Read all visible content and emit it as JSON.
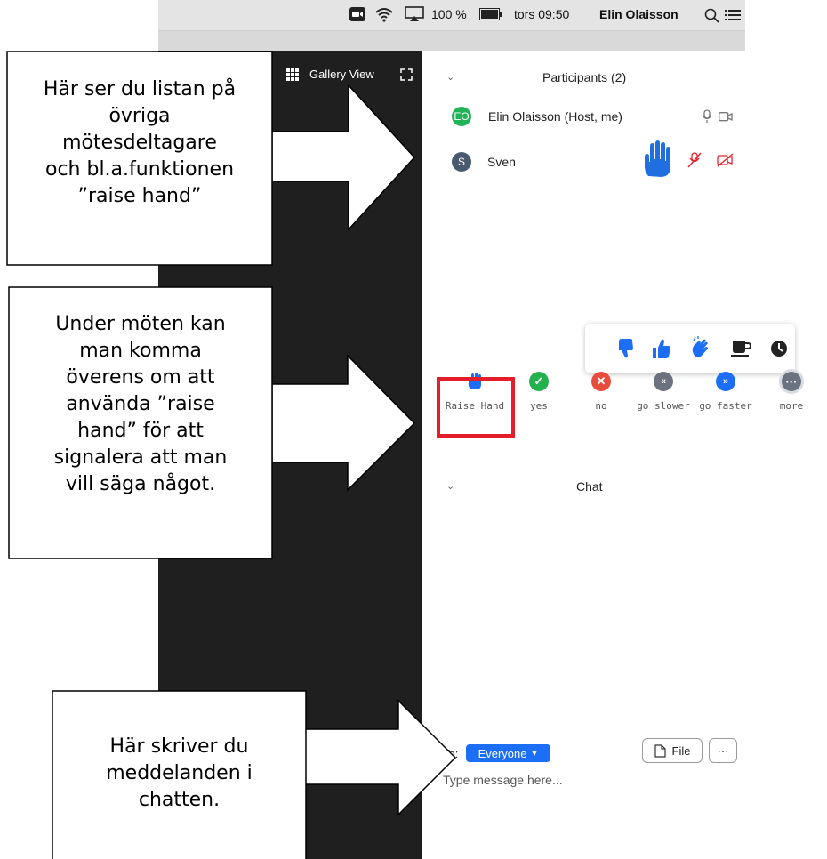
{
  "menubar": {
    "battery": "100 %",
    "datetime": "tors 09:50",
    "user": "Elin Olaisson"
  },
  "video": {
    "gallery_view_label": "Gallery View"
  },
  "participants": {
    "title": "Participants (2)",
    "list": [
      {
        "initials": "EO",
        "name": "Elin Olaisson (Host, me)",
        "avatar_color": "#21b357"
      },
      {
        "initials": "S",
        "name": "Sven",
        "avatar_color": "#4a5a6e"
      }
    ],
    "raised_hand_color": "#1f6fe0",
    "muted_color": "#e0262e"
  },
  "reactions": {
    "popup_icons": [
      "thumbs-down",
      "thumbs-up",
      "clap",
      "coffee",
      "clock"
    ],
    "buttons": [
      {
        "label": "Raise Hand",
        "color": "#1b6ef5",
        "icon": "hand"
      },
      {
        "label": "yes",
        "color": "#22b14c",
        "icon": "check"
      },
      {
        "label": "no",
        "color": "#e74c3c",
        "icon": "x"
      },
      {
        "label": "go slower",
        "color": "#6b7280",
        "icon": "rewind"
      },
      {
        "label": "go faster",
        "color": "#1b6ef5",
        "icon": "fast-forward"
      },
      {
        "label": "more",
        "color": "#6b7280",
        "icon": "ellipsis"
      }
    ],
    "highlight_color": "#e31d2a"
  },
  "chat": {
    "title": "Chat",
    "to_label": "To:",
    "recipient": "Everyone",
    "file_label": "File",
    "more_label": "···",
    "placeholder": "Type message here..."
  },
  "callouts": {
    "c1": [
      "Här ser du listan på",
      "övriga",
      "mötesdeltagare",
      "och bl.a.funktionen",
      "”raise hand”"
    ],
    "c2": [
      "Under möten kan",
      "man komma",
      "överens om att",
      "använda ”raise",
      "hand” för att",
      "signalera att man",
      "vill säga något."
    ],
    "c3": [
      "Här skriver du",
      "meddelanden i",
      "chatten."
    ]
  }
}
